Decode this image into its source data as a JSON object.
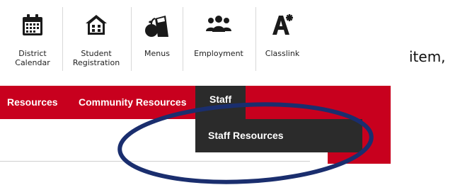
{
  "quicklinks": [
    {
      "label": "District\nCalendar",
      "icon": "calendar-icon"
    },
    {
      "label": "Student\nRegistration",
      "icon": "school-building-icon"
    },
    {
      "label": "Menus",
      "icon": "apple-lunch-icon"
    },
    {
      "label": "Employment",
      "icon": "people-group-icon"
    },
    {
      "label": "Classlink",
      "icon": "text-accessibility-icon"
    }
  ],
  "stray_text": "item,",
  "nav": {
    "items": [
      {
        "label": "Resources"
      },
      {
        "label": "Community Resources"
      },
      {
        "label": "Staff"
      }
    ],
    "dropdown": {
      "items": [
        {
          "label": "Staff Resources"
        }
      ]
    }
  },
  "colors": {
    "nav_red": "#c8001e",
    "dropdown_dark": "#2b2b2b",
    "annotation_blue": "#1a2e6e"
  }
}
